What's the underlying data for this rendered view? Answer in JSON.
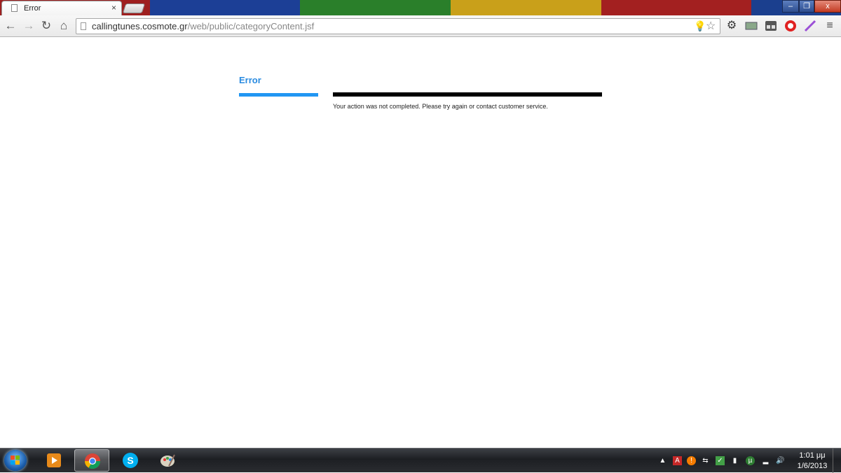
{
  "browser": {
    "tab_title": "Error",
    "tab_close": "×",
    "url_host": "callingtunes.cosmote.gr",
    "url_path": "/web/public/categoryContent.jsf",
    "window_controls": {
      "minimize": "–",
      "maximize": "❐",
      "close": "x"
    },
    "theme_stripes": [
      "#1b3f8e",
      "#2e8b2e",
      "#c9a21a",
      "#a12222",
      "#1b3f8e"
    ],
    "icons": [
      "back-arrow-icon",
      "forward-arrow-icon",
      "reload-icon",
      "home-icon",
      "bookmark-star-icon",
      "settings-icon",
      "menu-icon"
    ]
  },
  "page": {
    "heading": "Error",
    "message": "Your action was not completed. Please try again or contact customer service.",
    "accent_color": "#2196f3"
  },
  "taskbar": {
    "pinned": [
      "media-player",
      "chrome",
      "skype",
      "paint"
    ],
    "clock_time": "1:01 μμ",
    "clock_date": "1/6/2013"
  }
}
